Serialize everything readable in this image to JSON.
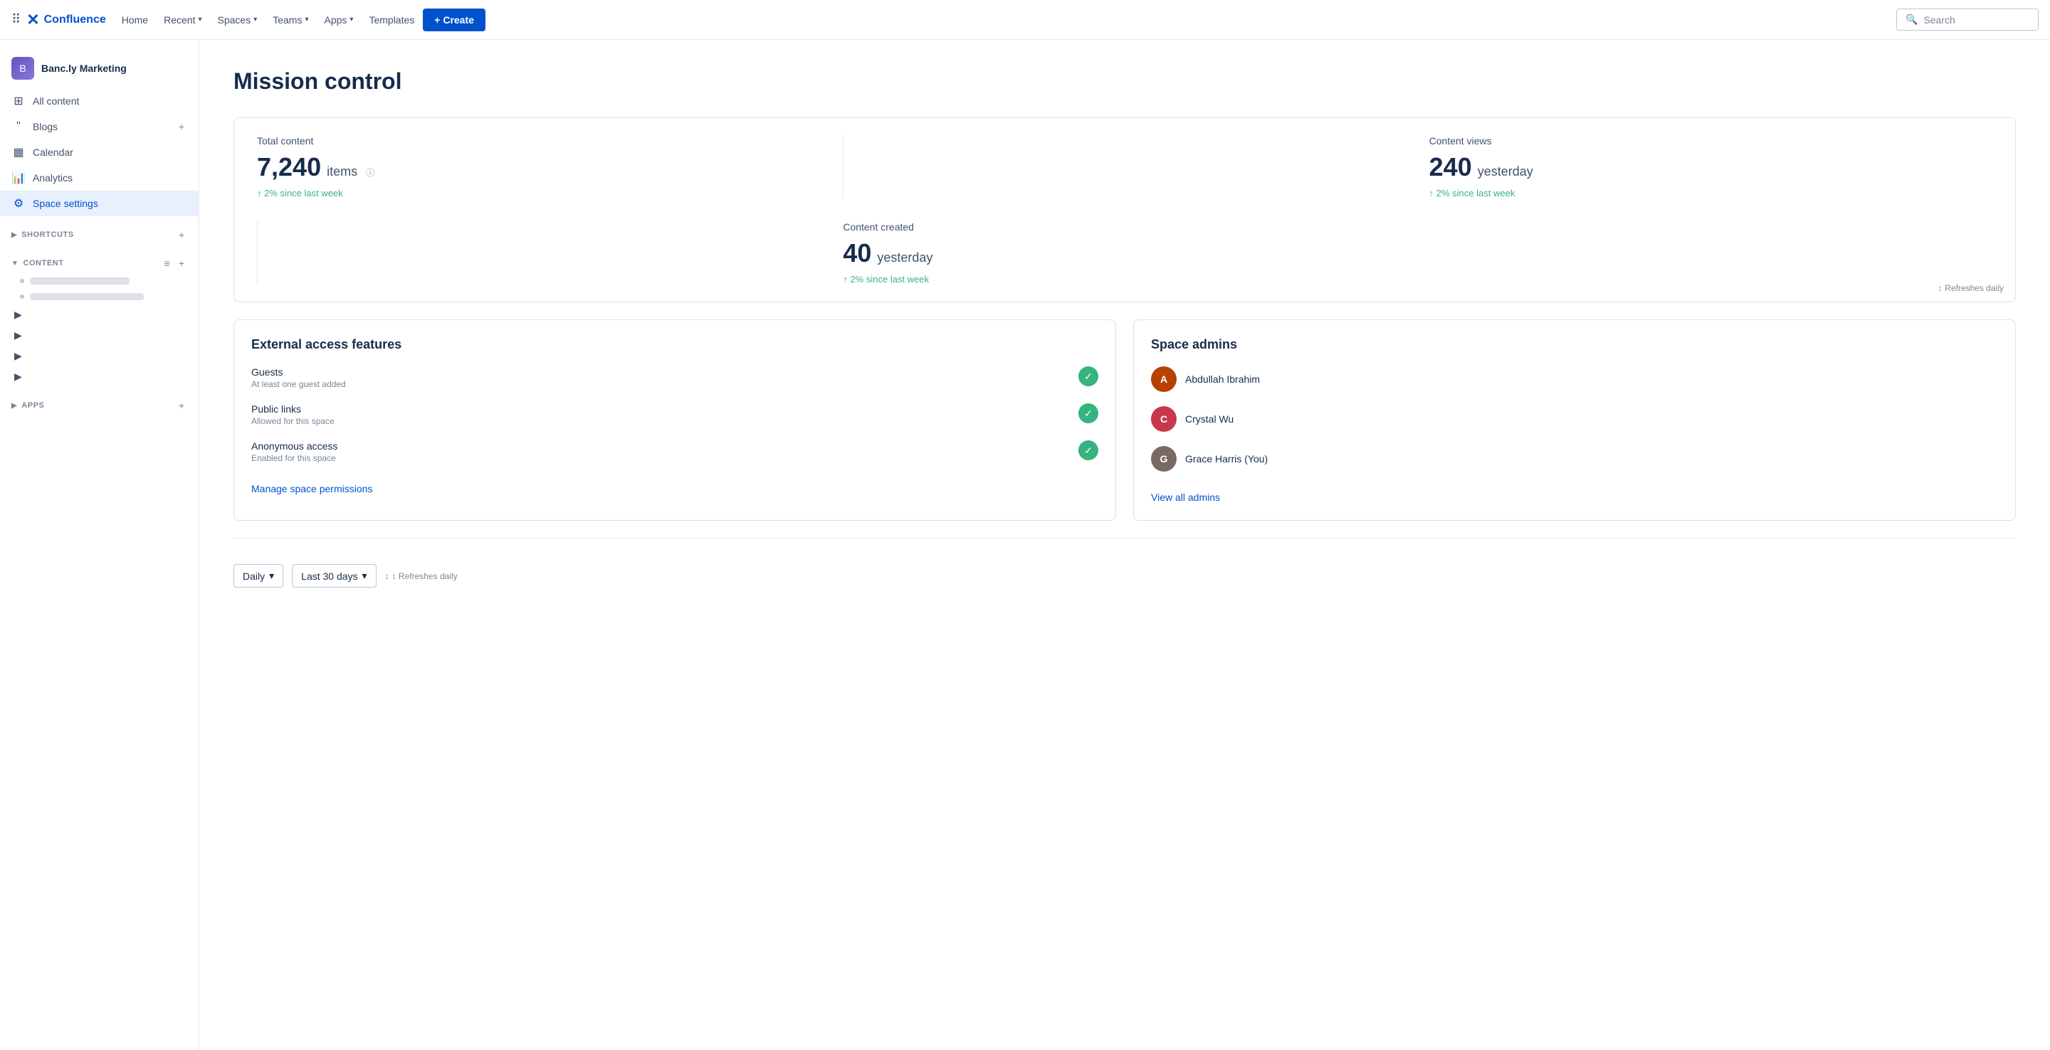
{
  "topnav": {
    "logo_text": "Confluence",
    "logo_x": "✕",
    "nav_items": [
      {
        "label": "Home",
        "has_dropdown": false
      },
      {
        "label": "Recent",
        "has_dropdown": true
      },
      {
        "label": "Spaces",
        "has_dropdown": true
      },
      {
        "label": "Teams",
        "has_dropdown": true
      },
      {
        "label": "Apps",
        "has_dropdown": true
      },
      {
        "label": "Templates",
        "has_dropdown": false
      }
    ],
    "create_label": "+ Create",
    "search_placeholder": "Search"
  },
  "sidebar": {
    "space_name": "Banc.ly Marketing",
    "nav_items": [
      {
        "label": "All content",
        "icon": "⊞"
      },
      {
        "label": "Blogs",
        "icon": "❝"
      },
      {
        "label": "Calendar",
        "icon": "📅"
      },
      {
        "label": "Analytics",
        "icon": "📊"
      },
      {
        "label": "Space settings",
        "icon": "⚙"
      }
    ],
    "shortcuts_label": "SHORTCUTS",
    "content_label": "CONTENT",
    "apps_label": "APPS"
  },
  "main": {
    "title": "Mission control",
    "stats": {
      "total_content": {
        "label": "Total content",
        "value": "7,240",
        "unit": "items",
        "trend": "↑ 2% since last week"
      },
      "content_views": {
        "label": "Content views",
        "value": "240",
        "unit": "yesterday",
        "trend": "↑ 2% since last week"
      },
      "content_created": {
        "label": "Content created",
        "value": "40",
        "unit": "yesterday",
        "trend": "↑ 2% since last week"
      },
      "refreshes_note": "↕ Refreshes daily"
    },
    "external_access": {
      "title": "External access features",
      "features": [
        {
          "name": "Guests",
          "desc": "At least one guest added"
        },
        {
          "name": "Public links",
          "desc": "Allowed for this space"
        },
        {
          "name": "Anonymous access",
          "desc": "Enabled for this space"
        }
      ],
      "manage_link": "Manage space permissions"
    },
    "space_admins": {
      "title": "Space admins",
      "admins": [
        {
          "name": "Abdullah Ibrahim",
          "color": "#b74200"
        },
        {
          "name": "Crystal Wu",
          "color": "#c9374a"
        },
        {
          "name": "Grace Harris (You)",
          "color": "#7a6960"
        }
      ],
      "view_link": "View all admins"
    },
    "bottom": {
      "daily_label": "Daily",
      "last30_label": "Last 30 days",
      "refresh_note": "↕ Refreshes daily"
    }
  }
}
